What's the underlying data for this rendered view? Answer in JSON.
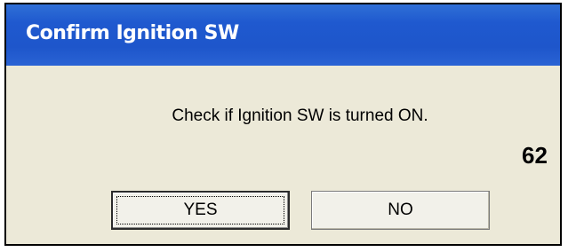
{
  "dialog": {
    "title": "Confirm Ignition SW",
    "message": "Check if Ignition SW is turned ON.",
    "buttons": {
      "yes_label": "YES",
      "no_label": "NO"
    }
  },
  "page_number": "62",
  "colors": {
    "titlebar": "#1e56cb",
    "dialog_background": "#ece9d8",
    "title_text": "#ffffff"
  }
}
